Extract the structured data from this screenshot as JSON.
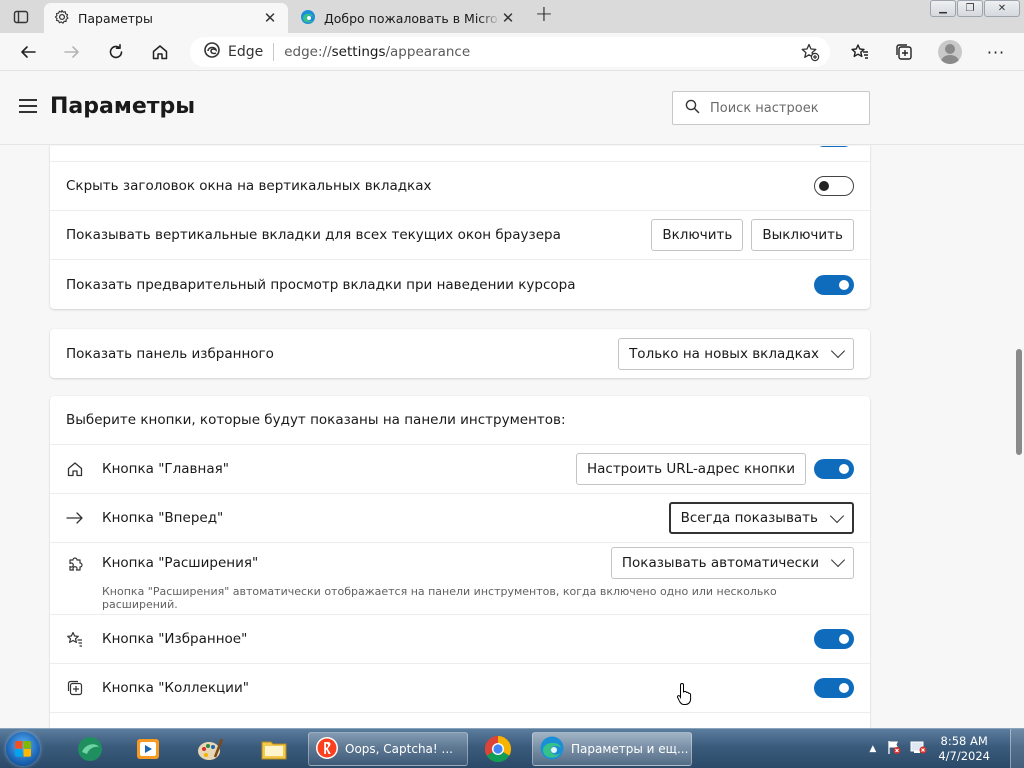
{
  "browser": {
    "tabs": [
      {
        "label": "Параметры",
        "active": true
      },
      {
        "label": "Добро пожаловать в Microsoft E",
        "active": false
      }
    ],
    "address": {
      "site_label": "Edge",
      "url_prefix": "edge://",
      "url_path": "settings",
      "url_rest": "/appearance"
    }
  },
  "header": {
    "title": "Параметры",
    "search_placeholder": "Поиск настроек"
  },
  "cards": {
    "tabs_card": {
      "rows": [
        {
          "label": "Скрыть заголовок окна на вертикальных вкладках",
          "toggle": "off"
        },
        {
          "label": "Показывать вертикальные вкладки для всех текущих окон браузера",
          "button_on": "Включить",
          "button_off": "Выключить"
        },
        {
          "label": "Показать предварительный просмотр вкладки при наведении курсора",
          "toggle": "on"
        }
      ]
    },
    "favorites_bar": {
      "label": "Показать панель избранного",
      "selected": "Только на новых вкладках"
    },
    "toolbar_buttons": {
      "heading": "Выберите кнопки, которые будут показаны на панели инструментов:",
      "rows": [
        {
          "icon": "home-icon",
          "label": "Кнопка \"Главная\"",
          "button": "Настроить URL-адрес кнопки",
          "toggle": "on"
        },
        {
          "icon": "forward-arrow-icon",
          "label": "Кнопка \"Вперед\"",
          "selected": "Всегда показывать"
        },
        {
          "icon": "puzzle-icon",
          "label": "Кнопка \"Расширения\"",
          "selected": "Показывать автоматически",
          "description": "Кнопка \"Расширения\" автоматически отображается на панели инструментов, когда включено одно или несколько расширений."
        },
        {
          "icon": "favorites-star-icon",
          "label": "Кнопка \"Избранное\"",
          "toggle": "on"
        },
        {
          "icon": "collections-icon",
          "label": "Кнопка \"Коллекции\"",
          "toggle": "on"
        }
      ]
    }
  },
  "taskbar": {
    "apps": [
      {
        "label": "Oops, Captcha! ...",
        "icon": "yandex-browser-icon"
      },
      {
        "label": "Параметры и ещ...",
        "icon": "edge-icon"
      }
    ],
    "clock": {
      "time": "8:58 AM",
      "date": "4/7/2024"
    }
  },
  "colors": {
    "accent": "#0f6cbd",
    "taskbar": "#3b5b7c"
  }
}
